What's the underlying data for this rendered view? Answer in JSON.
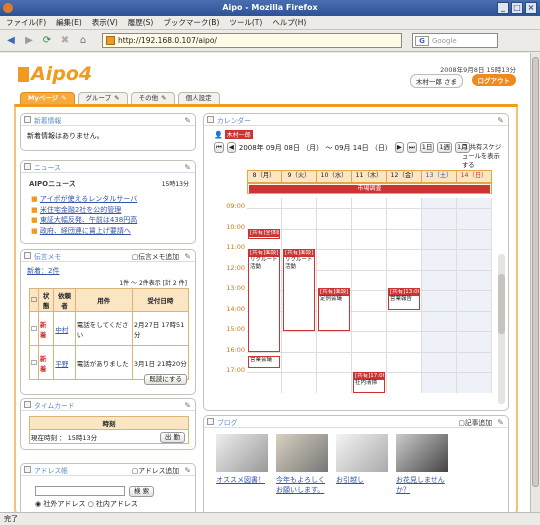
{
  "window": {
    "title": "Aipo - Mozilla Firefox"
  },
  "menu": [
    "ファイル(F)",
    "編集(E)",
    "表示(V)",
    "履歴(S)",
    "ブックマーク(B)",
    "ツール(T)",
    "ヘルプ(H)"
  ],
  "url": "http://192.168.0.107/aipo/",
  "search_placeholder": "Google",
  "status": "完了",
  "header": {
    "logo": "Aipo4",
    "date": "2008年9月8日 15時13分",
    "user": "木村一郎 さま",
    "logout": "ログアウト"
  },
  "tabs": [
    "Myページ",
    "グループ",
    "その他",
    "個人設定"
  ],
  "whatsnew": {
    "title": "新着情報",
    "body": "新着情報はありません。"
  },
  "news": {
    "title": "ニュース",
    "time": "15時13分",
    "brand": "AIPOニュース",
    "items": [
      "アイポが使えるレンタルサーバ",
      "米住宅金融2社を公的管理",
      "東証大幅反発、午前は438円高",
      "政府、経団連に賃上げ要請へ"
    ]
  },
  "memo": {
    "title": "伝言メモ",
    "add": "伝言メモ追加",
    "new_count": "新着：2件",
    "range": "1件 ～ 2件表示 [計 2 件]",
    "headers": [
      "",
      "状態",
      "依頼者",
      "用件",
      "受付日時"
    ],
    "rows": [
      {
        "state": "新着",
        "from": "中村",
        "subject": "電話をしてください",
        "date": "2月27日 17時51分"
      },
      {
        "state": "新着",
        "from": "平野",
        "subject": "電話がありました",
        "date": "3月1日 21時20分"
      }
    ],
    "read_btn": "既読にする"
  },
  "timecard": {
    "title": "タイムカード",
    "col": "時刻",
    "now": "現在時刻 ： 15時13分",
    "btn": "出 勤"
  },
  "address": {
    "title": "アドレス帳",
    "add": "アドレス追加",
    "search_btn": "検 索",
    "opt1": "社外アドレス",
    "opt2": "社内アドレス"
  },
  "calendar": {
    "title": "カレンダー",
    "user": "木村一郎",
    "range": "2008年 09月 08日 （月） ～ 09月 14日 （日）",
    "nav": [
      "1日",
      "1週",
      "1月"
    ],
    "share": "共有スケジュールを表示する",
    "days": [
      "8（月）",
      "9（火）",
      "10（水）",
      "11（木）",
      "12（金）",
      "13（土）",
      "14（日）"
    ],
    "times": [
      "09:00",
      "10:00",
      "11:00",
      "12:00",
      "13:00",
      "14:00",
      "15:00",
      "16:00",
      "17:00"
    ],
    "allday": "市場調査",
    "events": [
      {
        "day": 0,
        "head": "[共有]全体朝",
        "body": ""
      },
      {
        "day": 0,
        "head": "[共有]面談]1",
        "body": "リクルート活動"
      },
      {
        "day": 1,
        "head": "[共有]面談]1",
        "body": "リクルート活動"
      },
      {
        "day": 2,
        "head": "[共有]面談]1",
        "body": "定例会議"
      },
      {
        "day": 4,
        "head": "[共有]13:00-1",
        "body": "営業報告"
      },
      {
        "day": 0,
        "head": "",
        "body": "営業会議"
      },
      {
        "day": 3,
        "head": "[共有]17:00-1",
        "body": "社内清掃"
      }
    ]
  },
  "blog": {
    "title": "ブログ",
    "add": "記事追加",
    "items": [
      "オススメ図書！",
      "今年もよろしくお願いします。",
      "お引越し",
      "お花見しませんか？"
    ]
  },
  "colors": {
    "accent": "#f29a1e",
    "event": "#cc3333"
  }
}
